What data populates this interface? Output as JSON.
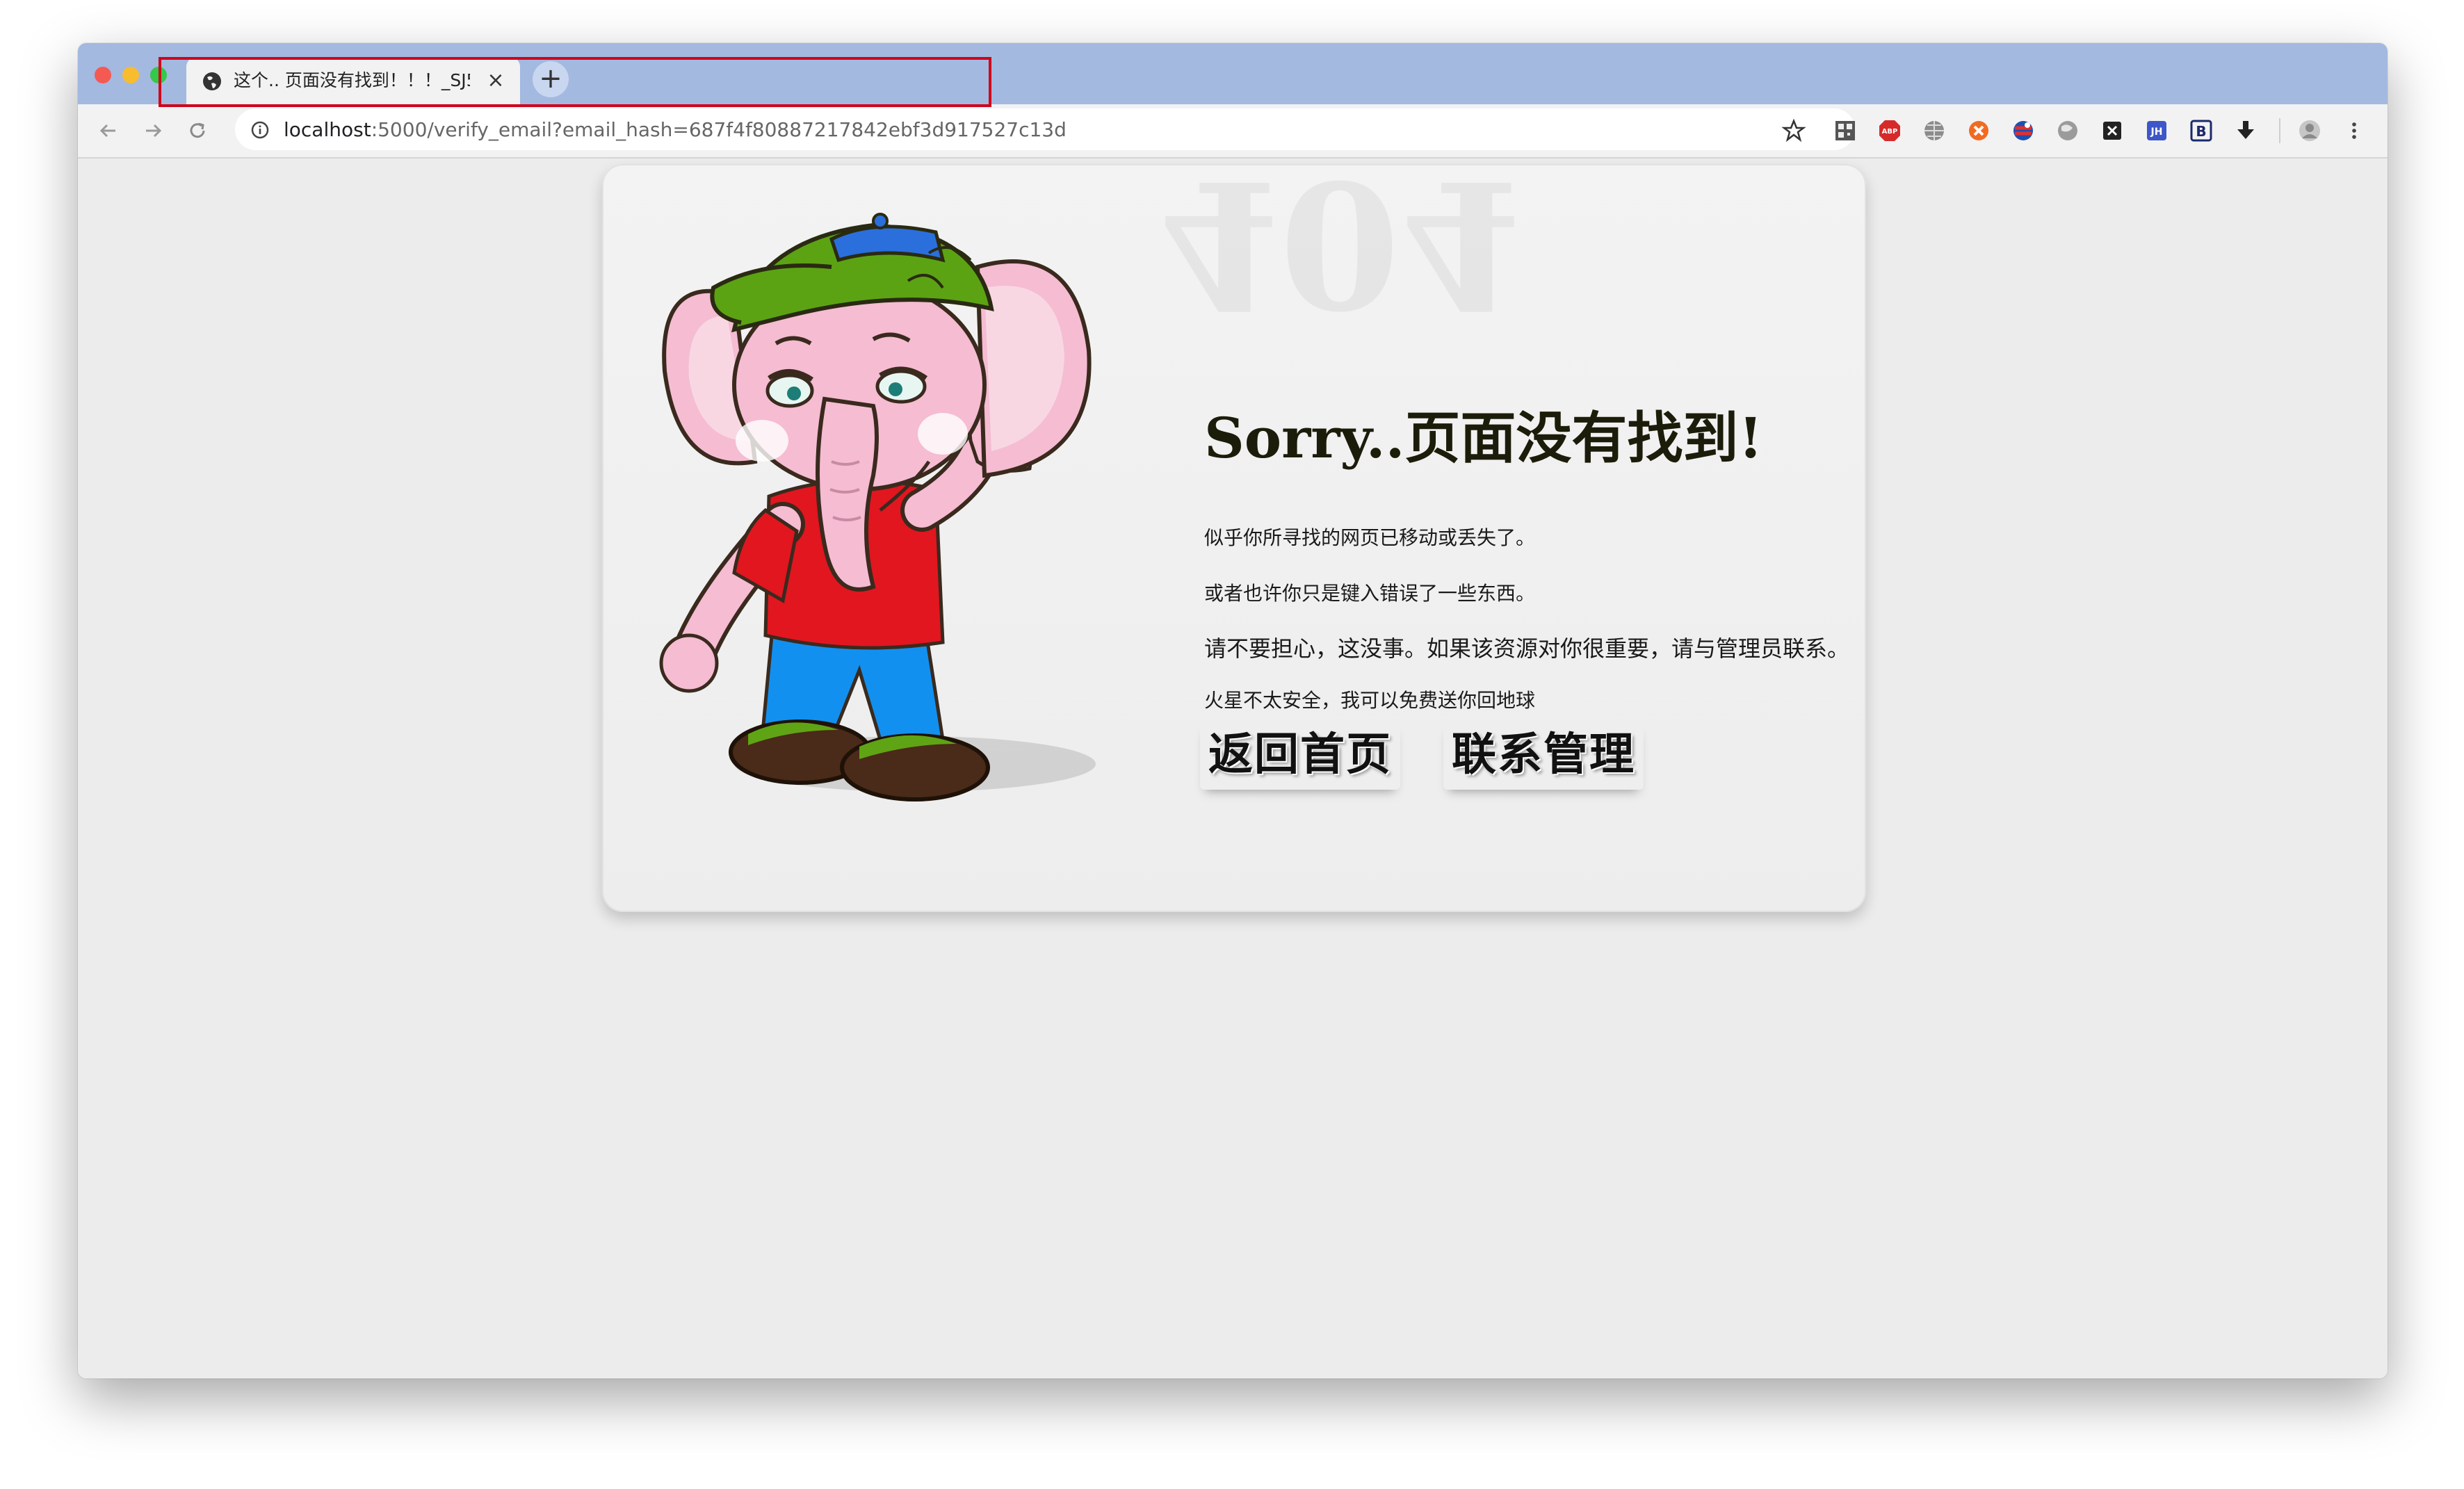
{
  "browser": {
    "tab_title": "这个.. 页面没有找到！！！_SJ5",
    "url_host": "localhost",
    "url_rest": ":5000/verify_email?email_hash=687f4f80887217842ebf3d917527c13d",
    "extension_icons": [
      "qr-code-icon",
      "adblock-icon",
      "globe-icon",
      "orange-ext-icon",
      "flag-ext-icon",
      "grey-globe-icon",
      "x-ext-icon",
      "jh-ext-icon",
      "b-ext-icon",
      "download-icon",
      "profile-icon",
      "menu-icon"
    ]
  },
  "page": {
    "ghost_text": "404",
    "heading": "Sorry..页面没有找到!",
    "line1": "似乎你所寻找的网页已移动或丢失了。",
    "line2": "或者也许你只是键入错误了一些东西。",
    "line3": "请不要担心，这没事。如果该资源对你很重要，请与管理员联系。",
    "line4": "火星不太安全，我可以免费送你回地球",
    "home_button": "返回首页",
    "contact_button": "联系管理"
  },
  "colors": {
    "tabbar": "#a3b9e0",
    "annotation": "#d0021b",
    "heading": "#1c1c0a"
  }
}
